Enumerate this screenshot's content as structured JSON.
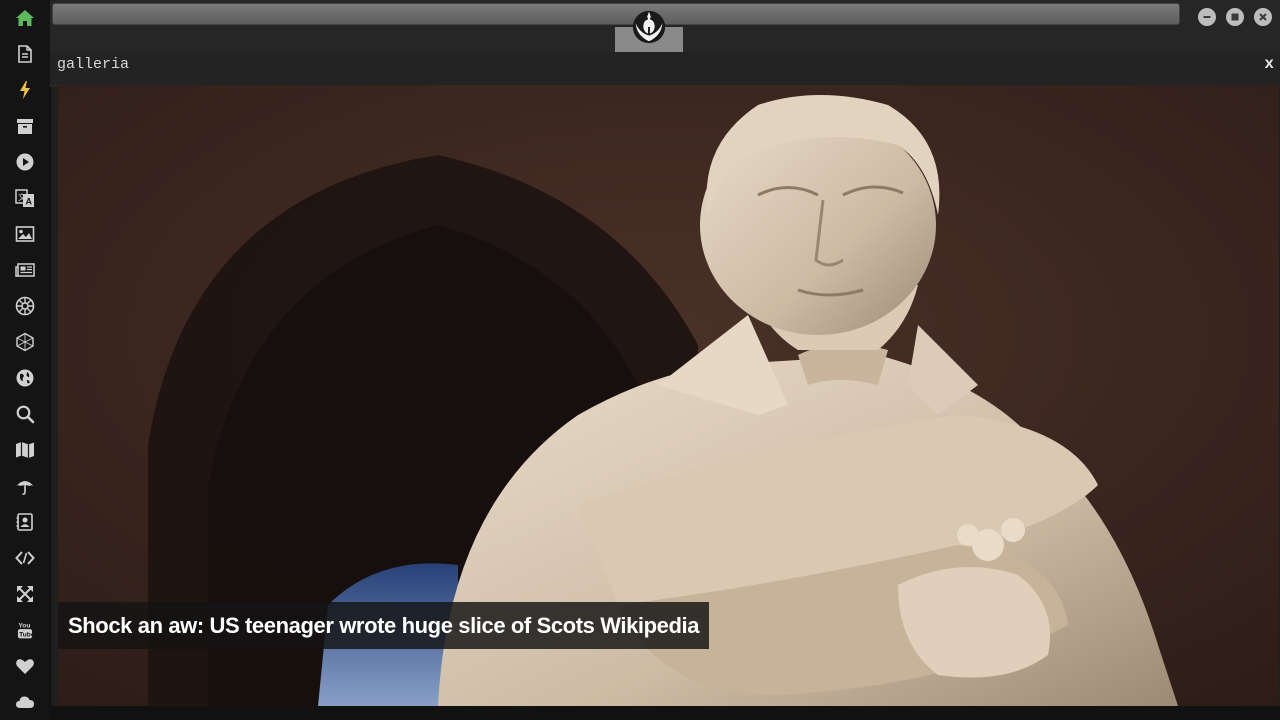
{
  "window": {
    "address_value": "",
    "controls": [
      "minimize",
      "maximize",
      "close"
    ]
  },
  "sidebar": {
    "items": [
      {
        "icon": "home-icon",
        "color": "#5cb85c"
      },
      {
        "icon": "document-icon",
        "color": "#d0d0d0"
      },
      {
        "icon": "bolt-icon",
        "color": "#f0c040"
      },
      {
        "icon": "archive-icon",
        "color": "#d0d0d0"
      },
      {
        "icon": "play-icon",
        "color": "#d0d0d0"
      },
      {
        "icon": "translate-icon",
        "color": "#d0d0d0"
      },
      {
        "icon": "image-icon",
        "color": "#d0d0d0"
      },
      {
        "icon": "newspaper-icon",
        "color": "#d0d0d0"
      },
      {
        "icon": "galactic-empire-icon",
        "color": "#d0d0d0"
      },
      {
        "icon": "hexagon-network-icon",
        "color": "#d0d0d0"
      },
      {
        "icon": "globe-icon",
        "color": "#d0d0d0"
      },
      {
        "icon": "search-icon",
        "color": "#d0d0d0"
      },
      {
        "icon": "map-icon",
        "color": "#d0d0d0"
      },
      {
        "icon": "umbrella-icon",
        "color": "#d0d0d0"
      },
      {
        "icon": "contact-card-icon",
        "color": "#d0d0d0"
      },
      {
        "icon": "code-icon",
        "color": "#d0d0d0"
      },
      {
        "icon": "expand-icon",
        "color": "#d0d0d0"
      },
      {
        "icon": "youtube-icon",
        "color": "#d0d0d0"
      },
      {
        "icon": "heart-icon",
        "color": "#d0d0d0"
      },
      {
        "icon": "cloud-icon",
        "color": "#d0d0d0"
      }
    ]
  },
  "tab": {
    "icon": "rebel-alliance-icon"
  },
  "panel": {
    "title": "galleria",
    "close_label": "x"
  },
  "gallery": {
    "image_subject": "marble-statue",
    "caption": "Shock an aw: US teenager wrote huge slice of Scots Wikipedia"
  }
}
